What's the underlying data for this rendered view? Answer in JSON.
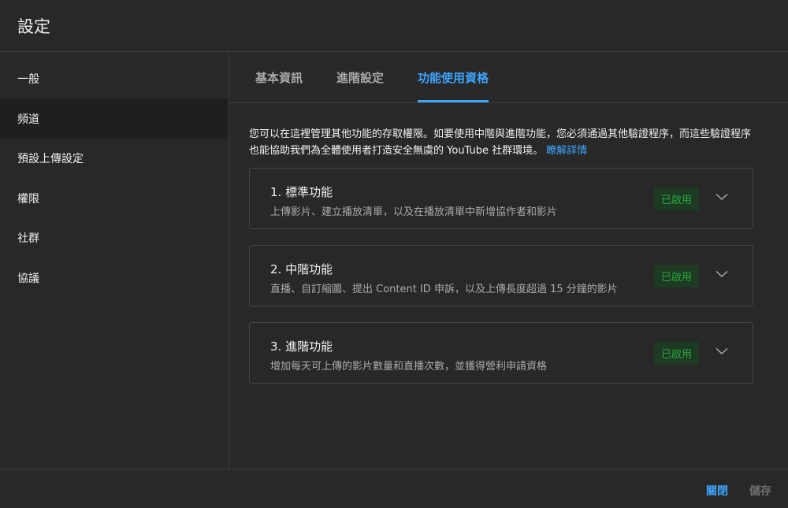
{
  "header": {
    "title": "設定"
  },
  "sidebar": {
    "items": [
      {
        "label": "一般"
      },
      {
        "label": "頻道"
      },
      {
        "label": "預設上傳設定"
      },
      {
        "label": "權限"
      },
      {
        "label": "社群"
      },
      {
        "label": "協議"
      }
    ],
    "active_index": 1
  },
  "tabs": [
    {
      "label": "基本資訊"
    },
    {
      "label": "進階設定"
    },
    {
      "label": "功能使用資格"
    }
  ],
  "description": {
    "text": "您可以在這裡管理其他功能的存取權限。如要使用中階與進階功能，您必須通過其他驗證程序，而這些驗證程序也能協助我們為全體使用者打造安全無虞的 YouTube 社群環境。",
    "link": "瞭解詳情"
  },
  "features": [
    {
      "title": "1. 標準功能",
      "subtitle": "上傳影片、建立播放清單，以及在播放清單中新增協作者和影片",
      "status": "已啟用"
    },
    {
      "title": "2. 中階功能",
      "subtitle": "直播、自訂縮圖、提出 Content ID 申訴，以及上傳長度超過 15 分鐘的影片",
      "status": "已啟用"
    },
    {
      "title": "3. 進階功能",
      "subtitle": "增加每天可上傳的影片數量和直播次數，並獲得營利申請資格",
      "status": "已啟用"
    }
  ],
  "footer": {
    "close_label": "關閉",
    "save_label": "儲存"
  },
  "colors": {
    "accent": "#3ea6ff",
    "enabled_text": "#2ba640",
    "enabled_bg": "#1d3a22",
    "background": "#282828"
  }
}
